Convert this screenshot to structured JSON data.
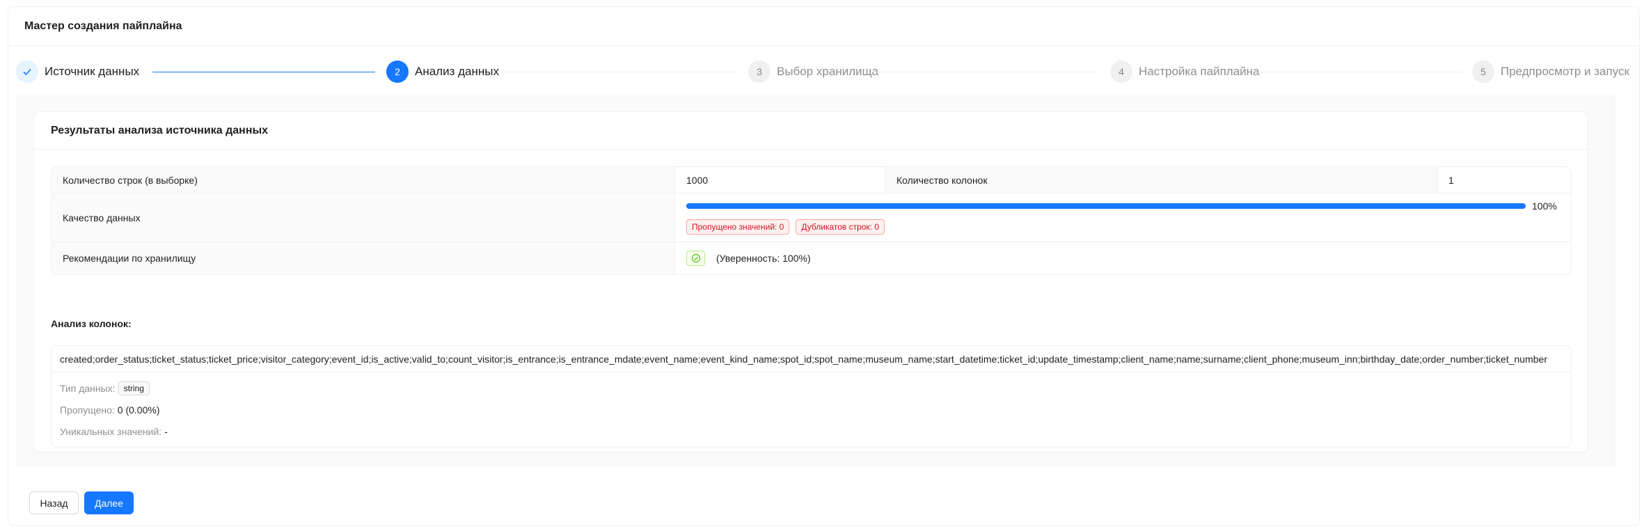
{
  "header": {
    "title": "Мастер создания пайплайна"
  },
  "steps": [
    {
      "number": "1",
      "title": "Источник данных",
      "status": "finish"
    },
    {
      "number": "2",
      "title": "Анализ данных",
      "status": "process"
    },
    {
      "number": "3",
      "title": "Выбор хранилища",
      "status": "wait"
    },
    {
      "number": "4",
      "title": "Настройка пайплайна",
      "status": "wait"
    },
    {
      "number": "5",
      "title": "Предпросмотр и запуск",
      "status": "wait"
    }
  ],
  "result": {
    "title": "Результаты анализа источника данных",
    "rows_label": "Количество строк (в выборке)",
    "rows_value": "1000",
    "cols_label": "Количество колонок",
    "cols_value": "1",
    "quality_label": "Качество данных",
    "quality_percent": 100,
    "quality_text": "100%",
    "missing_tag": "Пропущено значений: 0",
    "duplicates_tag": "Дубликатов строк: 0",
    "storage_label": "Рекомендации по хранилищу",
    "confidence_text": "(Уверенность: 100%)"
  },
  "columns": {
    "title": "Анализ колонок:",
    "column_name": "created;order_status;ticket_status;ticket_price;visitor_category;event_id;is_active;valid_to;count_visitor;is_entrance;is_entrance_mdate;event_name;event_kind_name;spot_id;spot_name;museum_name;start_datetime;ticket_id;update_timestamp;client_name;name;surname;client_phone;museum_inn;birthday_date;order_number;ticket_number",
    "type_label": "Тип данных:",
    "type_value": "string",
    "missing_label": "Пропущено:",
    "missing_value": "0 (0.00%)",
    "unique_label": "Уникальных значений:",
    "unique_value": "-"
  },
  "buttons": {
    "back": "Назад",
    "next": "Далее"
  },
  "colors": {
    "primary": "#1677ff",
    "success": "#52c41a",
    "error": "#cf1322"
  }
}
